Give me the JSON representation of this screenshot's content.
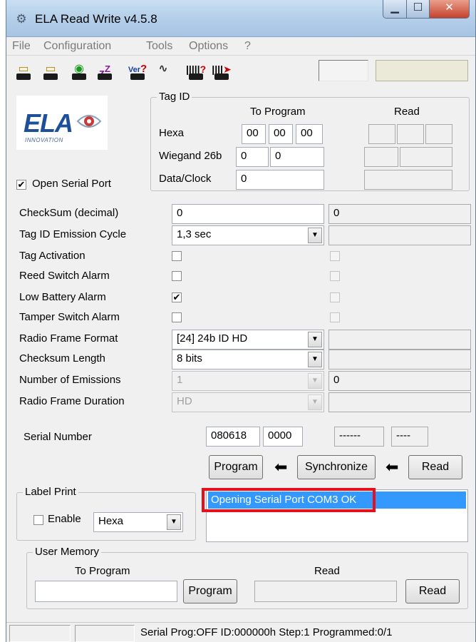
{
  "window": {
    "title": "ELA Read Write v4.5.8"
  },
  "menu": [
    "File",
    "Configuration",
    "Tools",
    "Options",
    "?"
  ],
  "toolbar": {
    "icons": [
      "open-icon",
      "save-icon",
      "radio-icon",
      "sleep-icon",
      "version-icon",
      "signal-icon",
      "barcode-query-icon",
      "barcode-write-icon"
    ],
    "glyphs": {
      "sleep": "z",
      "sleep_sup": "Z",
      "version": "Ver",
      "query": "?"
    }
  },
  "logo": {
    "text": "ELA",
    "subtitle": "INNOVATION"
  },
  "tag_id": {
    "title": "Tag ID",
    "to_program_label": "To Program",
    "read_label": "Read",
    "rows": {
      "hexa": {
        "label": "Hexa",
        "values": [
          "00",
          "00",
          "00"
        ]
      },
      "wiegand": {
        "label": "Wiegand 26b",
        "values": [
          "0",
          "0"
        ]
      },
      "dataclock": {
        "label": "Data/Clock",
        "values": [
          "0"
        ]
      }
    }
  },
  "open_serial_port": {
    "label": "Open Serial Port",
    "checked": true,
    "check": "✔"
  },
  "params": {
    "checksum": {
      "label": "CheckSum (decimal)",
      "program": "0",
      "read": "0"
    },
    "emission_cycle": {
      "label": "Tag ID Emission Cycle",
      "selected": "1,3 sec"
    },
    "tag_activation": {
      "label": "Tag Activation"
    },
    "reed_switch": {
      "label": "Reed Switch Alarm"
    },
    "low_battery": {
      "label": "Low Battery Alarm",
      "check": "✔"
    },
    "tamper": {
      "label": "Tamper Switch Alarm"
    },
    "frame_format": {
      "label": "Radio Frame Format",
      "selected": "[24] 24b ID HD"
    },
    "checksum_length": {
      "label": "Checksum Length",
      "selected": "8 bits"
    },
    "num_emissions": {
      "label": "Number of Emissions",
      "selected": "1",
      "read": "0"
    },
    "frame_duration": {
      "label": "Radio Frame Duration",
      "selected": "HD"
    }
  },
  "serial": {
    "label": "Serial Number",
    "program_values": [
      "080618",
      "0000"
    ],
    "read_values": [
      "------",
      "----"
    ]
  },
  "buttons": {
    "program": "Program",
    "synchronize": "Synchronize",
    "read": "Read"
  },
  "arrow_glyph": "⬅",
  "label_print": {
    "title": "Label Print",
    "enable_label": "Enable",
    "format": "Hexa"
  },
  "log": {
    "items": [
      "Opening Serial Port COM3 OK"
    ]
  },
  "user_memory": {
    "title": "User Memory",
    "to_program_label": "To Program",
    "read_label": "Read",
    "program_button": "Program",
    "read_button": "Read"
  },
  "status": {
    "text": "Serial Prog:OFF ID:000000h  Step:1  Programmed:0/1"
  }
}
